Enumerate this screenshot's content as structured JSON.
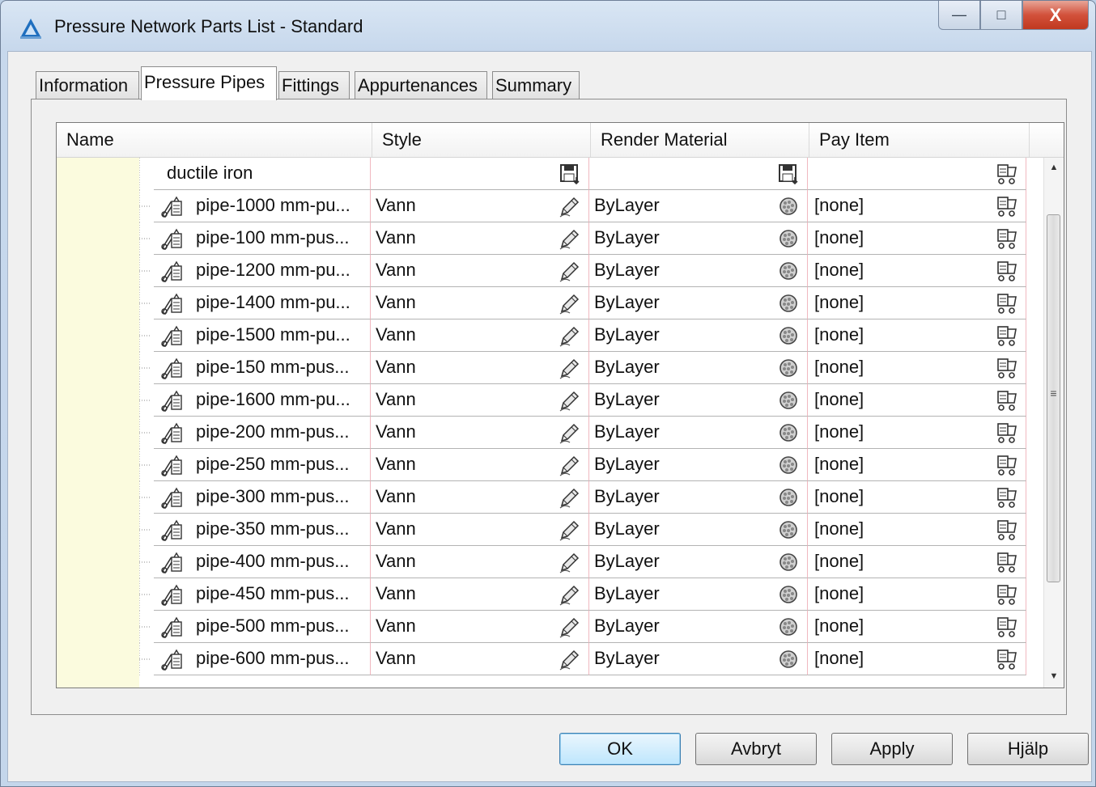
{
  "window": {
    "title": "Pressure Network Parts List - Standard",
    "min_glyph": "—",
    "max_glyph": "□",
    "close_glyph": "X"
  },
  "tabs": [
    {
      "label": "Information",
      "active": false
    },
    {
      "label": "Pressure Pipes",
      "active": true
    },
    {
      "label": "Fittings",
      "active": false
    },
    {
      "label": "Appurtenances",
      "active": false
    },
    {
      "label": "Summary",
      "active": false
    }
  ],
  "grid": {
    "columns": [
      "Name",
      "Style",
      "Render Material",
      "Pay Item"
    ],
    "group": {
      "name": "ductile iron",
      "expanded": true,
      "toggle": "−"
    },
    "rows": [
      {
        "name": "pipe-1000 mm-pu...",
        "style": "Vann",
        "material": "ByLayer",
        "pay_item": "[none]"
      },
      {
        "name": "pipe-100 mm-pus...",
        "style": "Vann",
        "material": "ByLayer",
        "pay_item": "[none]"
      },
      {
        "name": "pipe-1200 mm-pu...",
        "style": "Vann",
        "material": "ByLayer",
        "pay_item": "[none]"
      },
      {
        "name": "pipe-1400 mm-pu...",
        "style": "Vann",
        "material": "ByLayer",
        "pay_item": "[none]"
      },
      {
        "name": "pipe-1500 mm-pu...",
        "style": "Vann",
        "material": "ByLayer",
        "pay_item": "[none]"
      },
      {
        "name": "pipe-150 mm-pus...",
        "style": "Vann",
        "material": "ByLayer",
        "pay_item": "[none]"
      },
      {
        "name": "pipe-1600 mm-pu...",
        "style": "Vann",
        "material": "ByLayer",
        "pay_item": "[none]"
      },
      {
        "name": "pipe-200 mm-pus...",
        "style": "Vann",
        "material": "ByLayer",
        "pay_item": "[none]"
      },
      {
        "name": "pipe-250 mm-pus...",
        "style": "Vann",
        "material": "ByLayer",
        "pay_item": "[none]"
      },
      {
        "name": "pipe-300 mm-pus...",
        "style": "Vann",
        "material": "ByLayer",
        "pay_item": "[none]"
      },
      {
        "name": "pipe-350 mm-pus...",
        "style": "Vann",
        "material": "ByLayer",
        "pay_item": "[none]"
      },
      {
        "name": "pipe-400 mm-pus...",
        "style": "Vann",
        "material": "ByLayer",
        "pay_item": "[none]"
      },
      {
        "name": "pipe-450 mm-pus...",
        "style": "Vann",
        "material": "ByLayer",
        "pay_item": "[none]"
      },
      {
        "name": "pipe-500 mm-pus...",
        "style": "Vann",
        "material": "ByLayer",
        "pay_item": "[none]"
      },
      {
        "name": "pipe-600 mm-pus...",
        "style": "Vann",
        "material": "ByLayer",
        "pay_item": "[none]"
      }
    ],
    "scroll_glyphs": {
      "up": "▲",
      "down": "▼",
      "grip": "≡"
    }
  },
  "buttons": {
    "ok": "OK",
    "cancel": "Avbryt",
    "apply": "Apply",
    "help": "Hjälp"
  },
  "icons": {
    "app": "autocad-civil-icon",
    "part": "pipe-part-icon",
    "style_edit": "pencil-edit-icon",
    "material": "render-material-sphere-icon",
    "pay_item": "pay-item-icon",
    "save_column": "save-column-icon"
  }
}
